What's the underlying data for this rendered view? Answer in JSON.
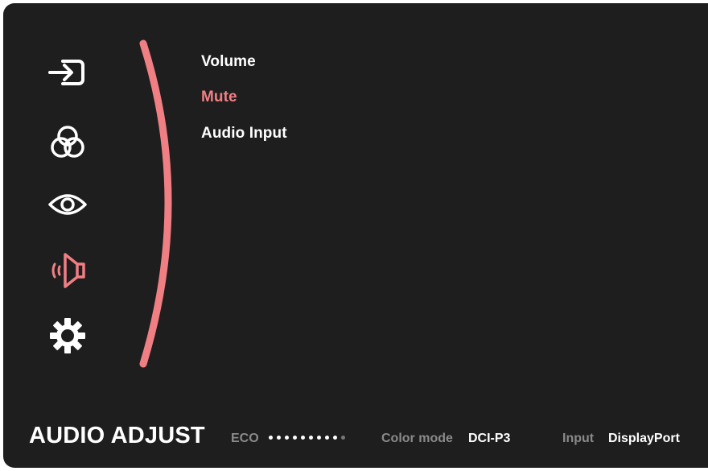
{
  "sidebar": {
    "icons": [
      {
        "name": "input-source-icon"
      },
      {
        "name": "color-adjust-icon"
      },
      {
        "name": "view-mode-icon"
      },
      {
        "name": "audio-adjust-icon"
      },
      {
        "name": "setup-menu-icon"
      }
    ],
    "active_index": 3
  },
  "menu": {
    "items": [
      {
        "label": "Volume"
      },
      {
        "label": "Mute"
      },
      {
        "label": "Audio Input"
      }
    ],
    "selected_index": 1
  },
  "footer": {
    "title": "AUDIO ADJUST",
    "eco_label": "ECO",
    "eco_level": 9,
    "eco_max": 10,
    "color_mode_label": "Color mode",
    "color_mode_value": "DCI-P3",
    "input_label": "Input",
    "input_value": "DisplayPort"
  },
  "colors": {
    "background": "#1e1e1e",
    "accent": "#f07f84",
    "text": "#ffffff",
    "muted": "#8a8a8a"
  }
}
